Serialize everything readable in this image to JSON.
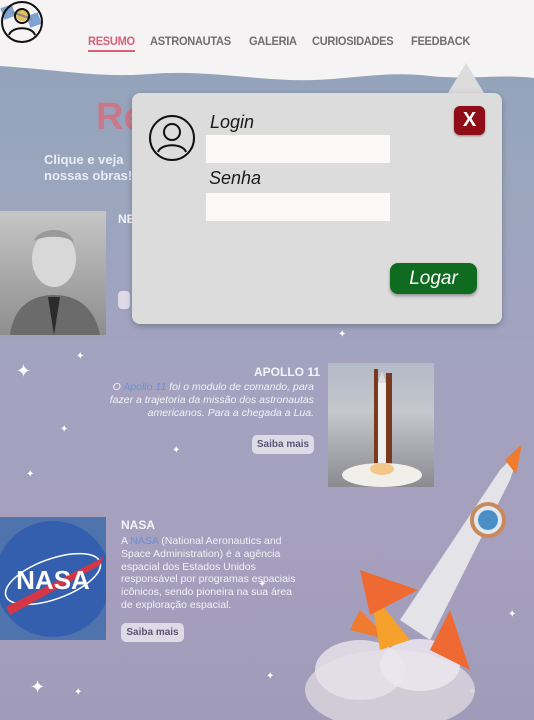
{
  "nav": {
    "items": [
      {
        "label": "RESUMO",
        "active": true
      },
      {
        "label": "ASTRONAUTAS",
        "active": false
      },
      {
        "label": "GALERIA",
        "active": false
      },
      {
        "label": "CURIOSIDADES",
        "active": false
      },
      {
        "label": "FEEDBACK",
        "active": false
      }
    ]
  },
  "hero": {
    "title_visible": "Re",
    "subtitle": "Clique e veja nossas obras!"
  },
  "cards": {
    "armstrong": {
      "title": "NE"
    },
    "apollo": {
      "title": "APOLLO 11",
      "text_pre": "O ",
      "text_highlight": "Apollo 11",
      "text_post": " foi o modulo de comando, para fazer a trajetoria da missão dos astronautas americanos. Para a chegada a Lua.",
      "button": "Saiba mais"
    },
    "nasa": {
      "title": "NASA",
      "text_pre": "A ",
      "text_highlight": "NASA",
      "text_post": " (National Aeronautics and Space Administration) é a agência espacial dos Estados Unidos responsável por programas espaciais icônicos, sendo pioneira na sua área de exploração espacial.",
      "button": "Saiba mais",
      "logo_text": "NASA"
    }
  },
  "modal": {
    "login_label": "Login",
    "password_label": "Senha",
    "login_value": "",
    "password_value": "",
    "close_label": "X",
    "submit_label": "Logar"
  },
  "colors": {
    "accent": "#d9607a",
    "close": "#8e0d17",
    "submit": "#0e6b1f",
    "link": "#6f8fd6"
  }
}
